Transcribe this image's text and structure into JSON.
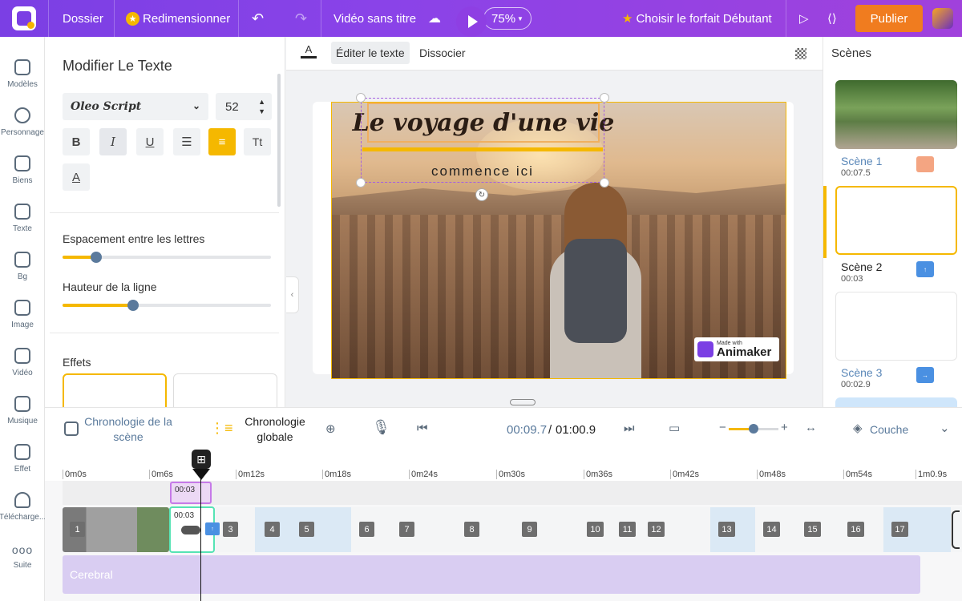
{
  "topbar": {
    "dossier": "Dossier",
    "resize": "Redimensionner",
    "video_title": "Vidéo sans titre",
    "zoom": "75%",
    "plan": "Choisir le forfait Débutant",
    "publish": "Publier"
  },
  "rail": [
    {
      "label": "Modèles",
      "icon": "templates-icon"
    },
    {
      "label": "Personnage",
      "icon": "character-icon"
    },
    {
      "label": "Biens",
      "icon": "props-icon"
    },
    {
      "label": "Texte",
      "icon": "text-icon"
    },
    {
      "label": "Bg",
      "icon": "background-icon"
    },
    {
      "label": "Image",
      "icon": "image-icon"
    },
    {
      "label": "Vidéo",
      "icon": "video-icon"
    },
    {
      "label": "Musique",
      "icon": "music-icon"
    },
    {
      "label": "Effet",
      "icon": "effect-icon"
    },
    {
      "label": "Télécharge...",
      "icon": "upload-icon"
    },
    {
      "label": "Suite",
      "icon": "more-icon"
    }
  ],
  "panel": {
    "title": "Modifier Le Texte",
    "font": "Oleo Script",
    "size": "52",
    "letter_spacing_label": "Espacement entre les lettres",
    "letter_spacing_value": 0.16,
    "line_height_label": "Hauteur de la ligne",
    "line_height_value": 0.34,
    "effects_label": "Effets"
  },
  "canvas_toolbar": {
    "edit_text": "Éditer le texte",
    "dissociate": "Dissocier"
  },
  "stage": {
    "title": "Le voyage d'une vie",
    "subtitle": "commence ici",
    "watermark_small": "Made with",
    "watermark_big": "Animaker"
  },
  "scenes": {
    "title": "Scènes",
    "items": [
      {
        "name": "Scène 1",
        "time": "00:07.5",
        "badge_color": "#f4a582"
      },
      {
        "name": "Scène 2",
        "time": "00:03",
        "badge_color": "#4a90e2"
      },
      {
        "name": "Scène 3",
        "time": "00:02.9",
        "badge_color": "#4a90e2"
      }
    ]
  },
  "timeline": {
    "scene_timeline": "Chronologie de la scène",
    "global_timeline": "Chronologie globale",
    "current_time": "00:09.7",
    "separator": "/",
    "total_time": "01:00.9",
    "layer": "Couche",
    "ticks": [
      "0m0s",
      "0m6s",
      "0m12s",
      "0m18s",
      "0m24s",
      "0m30s",
      "0m36s",
      "0m42s",
      "0m48s",
      "0m54s",
      "1m0.9s"
    ],
    "scene_block_time": "00:03",
    "scene2_time": "00:03",
    "numbers": [
      "1",
      "3",
      "4",
      "5",
      "6",
      "7",
      "8",
      "9",
      "10",
      "11",
      "12",
      "13",
      "14",
      "15",
      "16",
      "17"
    ],
    "audio": "Cerebral"
  },
  "colors": {
    "accent": "#8e3fe3",
    "yellow": "#f5b800",
    "publish": "#f07c1f"
  }
}
